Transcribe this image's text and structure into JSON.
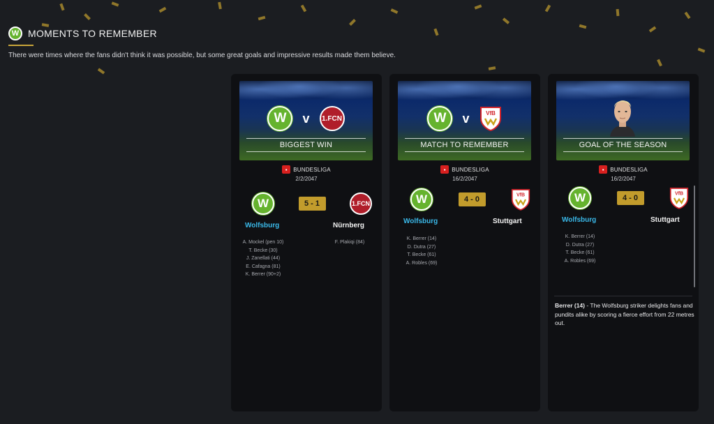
{
  "header": {
    "title": "MOMENTS TO REMEMBER",
    "subtitle": "There were times where the fans didn't think it was possible, but some great goals and impressive results made them believe."
  },
  "colors": {
    "accent_gold": "#c29c2c",
    "home_team_blue": "#3ab8e8",
    "wolfsburg_green": "#65b32e",
    "card_bg": "#0f1013"
  },
  "cards": [
    {
      "banner_label": "BIGGEST WIN",
      "competition": "BUNDESLIGA",
      "date": "2/2/2047",
      "home_team": "Wolfsburg",
      "away_team": "Nürnberg",
      "score": "5 - 1",
      "home_crest": "W",
      "away_crest": "1.FCN",
      "home_scorers": [
        "A. Mockel (pen 10)",
        "T. Becke (30)",
        "J. Zanellati (44)",
        "E. Cafagna (81)",
        "K. Berrer (90+2)"
      ],
      "away_scorers": [
        "F. Plakiqi (84)"
      ],
      "banner_v": "v"
    },
    {
      "banner_label": "MATCH TO REMEMBER",
      "competition": "BUNDESLIGA",
      "date": "16/2/2047",
      "home_team": "Wolfsburg",
      "away_team": "Stuttgart",
      "score": "4 - 0",
      "home_crest": "W",
      "away_crest": "VfB",
      "home_scorers": [
        "K. Berrer (14)",
        "D. Dutra (27)",
        "T. Becke (61)",
        "A. Robles (69)"
      ],
      "away_scorers": [],
      "banner_v": "v"
    },
    {
      "banner_label": "GOAL OF THE SEASON",
      "competition": "BUNDESLIGA",
      "date": "16/2/2047",
      "home_team": "Wolfsburg",
      "away_team": "Stuttgart",
      "score": "4 - 0",
      "home_crest": "W",
      "away_crest": "VfB",
      "home_scorers": [
        "K. Berrer (14)",
        "D. Dutra (27)",
        "T. Becke (61)",
        "A. Robles (69)"
      ],
      "away_scorers": [],
      "goal_scorer": "Berrer (14)",
      "goal_description": " - The Wolfsburg striker delights fans and pundits alike by scoring a fierce effort from 22 metres out."
    }
  ]
}
